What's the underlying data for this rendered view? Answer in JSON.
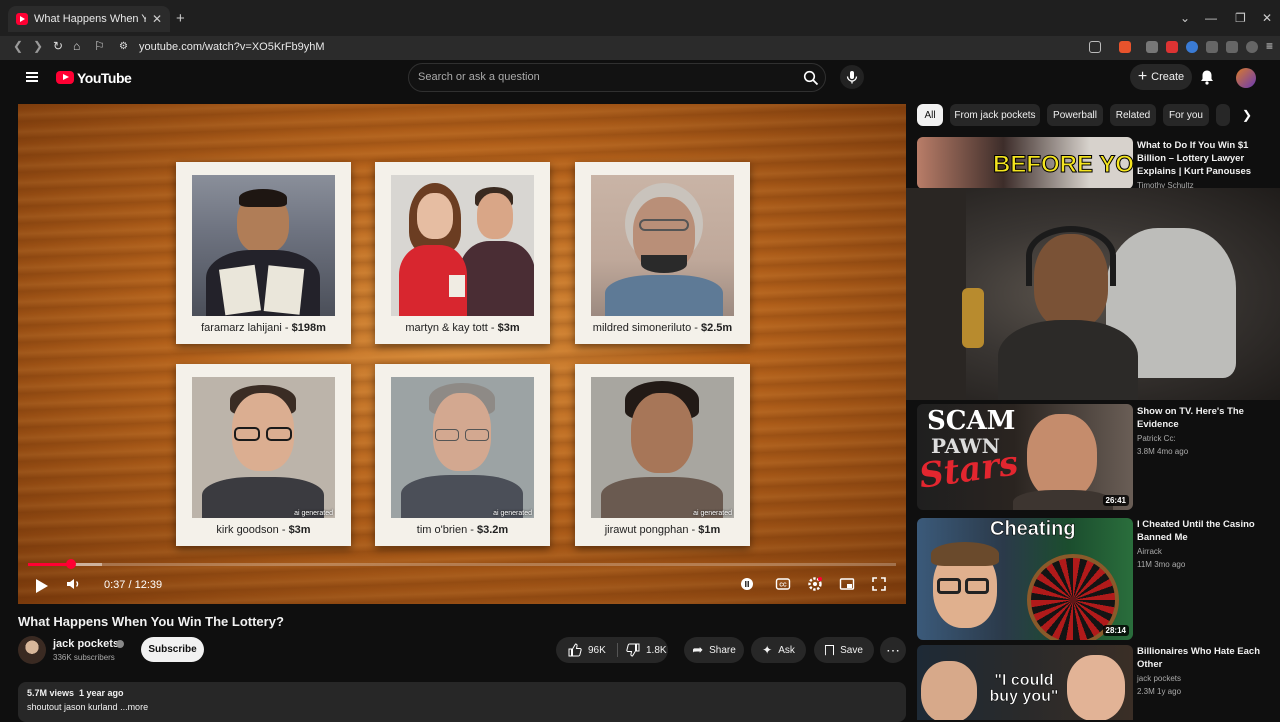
{
  "browser": {
    "tab_title": "What Happens When You Win T",
    "url": "youtube.com/watch?v=XO5KrFb9yhM"
  },
  "yt": {
    "logo": "YouTube",
    "search_placeholder": "Search or ask a question",
    "create_label": "Create"
  },
  "video": {
    "cards": [
      {
        "name": "faramarz lahijani - ",
        "amount": "$198m",
        "ai": ""
      },
      {
        "name": "martyn & kay tott - ",
        "amount": "$3m",
        "ai": ""
      },
      {
        "name": "mildred simoneriluto - ",
        "amount": "$2.5m",
        "ai": ""
      },
      {
        "name": "kirk goodson - ",
        "amount": "$3m",
        "ai": "ai generated"
      },
      {
        "name": "tim o'brien - ",
        "amount": "$3.2m",
        "ai": "ai generated"
      },
      {
        "name": "jirawut pongphan - ",
        "amount": "$1m",
        "ai": "ai generated"
      }
    ],
    "timecode": "0:37 / 12:39",
    "progress_fraction": 0.049
  },
  "info": {
    "title": "What Happens When You Win The Lottery?",
    "channel": "jack pockets",
    "subscribers": "336K subscribers",
    "subscribe_label": "Subscribe",
    "likes": "96K",
    "dislikes": "1.8K",
    "share_label": "Share",
    "ask_label": "Ask",
    "save_label": "Save",
    "views_line": "5.7M views  1 year ago",
    "description": "shoutout jason kurland ...more"
  },
  "chips": [
    "All",
    "From jack pockets",
    "Powerball",
    "Related",
    "For you"
  ],
  "recommendations": [
    {
      "title": "What to Do If You Win $1 Billion – Lottery Lawyer Explains | Kurt Panouses",
      "channel": "Timothy Schultz",
      "meta": "",
      "duration": "",
      "thumb_text": "BEFORE YOU"
    },
    {
      "title": "Show on TV. Here's The Evidence",
      "channel": "Patrick Cc:",
      "meta": "3.8M  4mo ago",
      "duration": "26:41",
      "thumb_text": "SCAM",
      "thumb_text2": "PAWN",
      "thumb_text3": "Stars"
    },
    {
      "title": "I Cheated Until the Casino Banned Me",
      "channel": "Airrack",
      "meta": "11M  3mo ago",
      "duration": "28:14",
      "thumb_text": "Cheating"
    },
    {
      "title": "Billionaires Who Hate Each Other",
      "channel": "jack pockets",
      "meta": "2.3M  1y ago",
      "duration": "",
      "thumb_text": "\"I could buy you\""
    }
  ]
}
